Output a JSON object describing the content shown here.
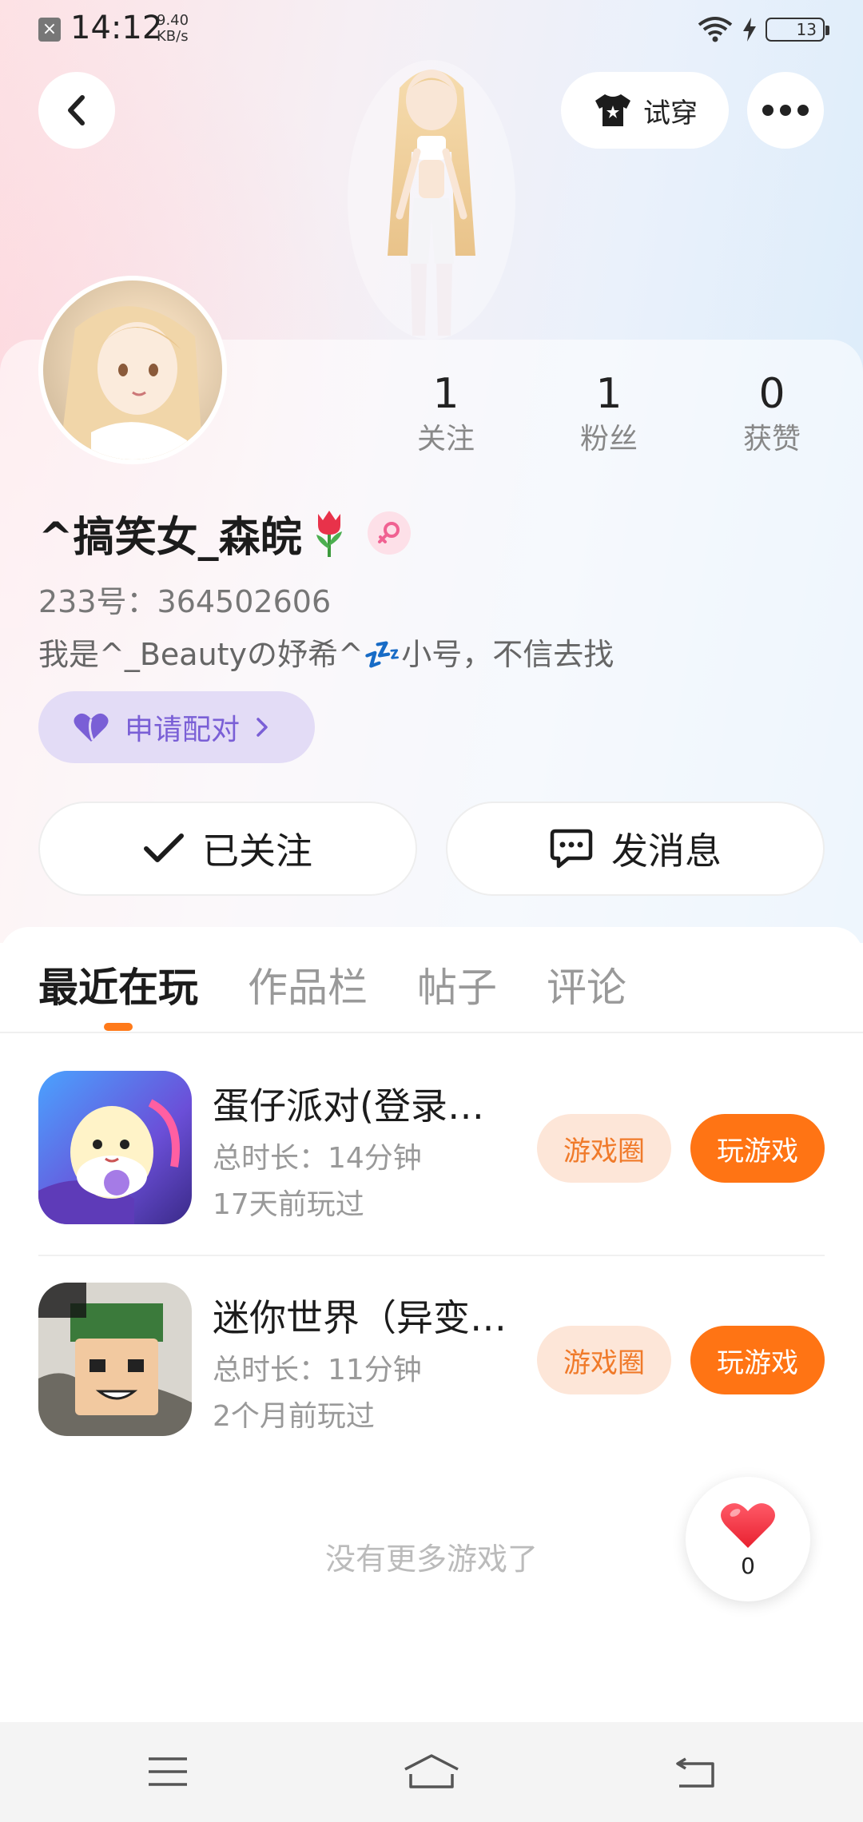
{
  "status_bar": {
    "time": "14:12",
    "speed_value": "9.40",
    "speed_unit": "KB/s",
    "battery": "13"
  },
  "header": {
    "tryon_label": "试穿"
  },
  "profile": {
    "stats": [
      {
        "value": "1",
        "label": "关注"
      },
      {
        "value": "1",
        "label": "粉丝"
      },
      {
        "value": "0",
        "label": "获赞"
      }
    ],
    "username": "^搞笑女_森皖",
    "account_id": "233号：364502606",
    "bio": "我是^_Beautyの妤希^💤小号，不信去找",
    "match_label": "申请配对",
    "follow_label": "已关注",
    "message_label": "发消息"
  },
  "tabs": [
    "最近在玩",
    "作品栏",
    "帖子",
    "评论"
  ],
  "games": [
    {
      "title": "蛋仔派对(登录…",
      "duration": "总时长：14分钟",
      "last_played": "17天前玩过",
      "circle_label": "游戏圈",
      "play_label": "玩游戏"
    },
    {
      "title": "迷你世界（异变…",
      "duration": "总时长：11分钟",
      "last_played": "2个月前玩过",
      "circle_label": "游戏圈",
      "play_label": "玩游戏"
    }
  ],
  "no_more_text": "没有更多游戏了",
  "like_count": "0",
  "colors": {
    "accent": "#ff7414",
    "accent_light": "#fde6d8",
    "match_bg": "#e3dcf6",
    "match_text": "#7a5fd6"
  }
}
